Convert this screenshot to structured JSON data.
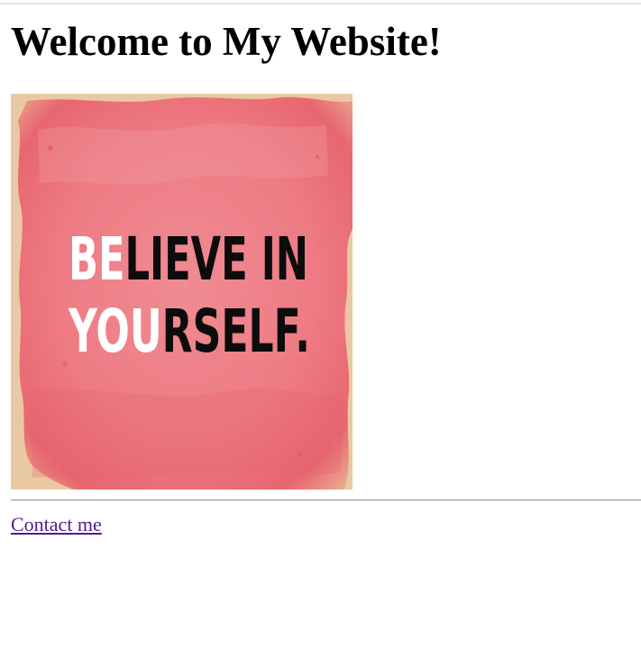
{
  "page": {
    "title": "Welcome to My Website!"
  },
  "poster": {
    "line1_highlight": "BE",
    "line1_rest": "LIEVE IN",
    "line2_highlight": "YOU",
    "line2_rest": "RSELF.",
    "highlight_color": "#ffffff",
    "text_color": "#0c0c0c",
    "paint_color": "#ee7880",
    "paper_color": "#e9c9a3"
  },
  "footer": {
    "contact_label": "Contact me",
    "link_color": "#551a8b"
  }
}
